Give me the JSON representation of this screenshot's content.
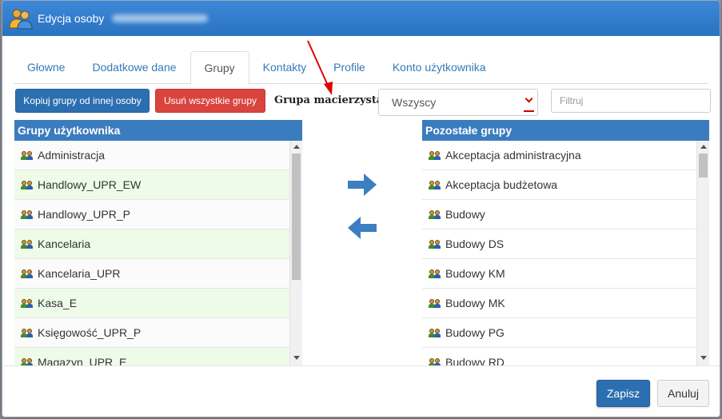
{
  "window": {
    "title": "Edycja osoby"
  },
  "tabs": [
    {
      "label": "Głowne",
      "active": false
    },
    {
      "label": "Dodatkowe dane",
      "active": false
    },
    {
      "label": "Grupy",
      "active": true
    },
    {
      "label": "Kontakty",
      "active": false
    },
    {
      "label": "Profile",
      "active": false
    },
    {
      "label": "Konto użytkownika",
      "active": false
    }
  ],
  "toolbar": {
    "copy_label": "Kopiuj grupy od innej osoby",
    "remove_label": "Usuń wszystkie grupy",
    "parent_group_label": "Grupa macierzysta:",
    "parent_group_value": "Wszyscy",
    "filter_placeholder": "Filtruj"
  },
  "left_panel": {
    "header": "Grupy użytkownika",
    "items": [
      "Administracja",
      "Handlowy_UPR_EW",
      "Handlowy_UPR_P",
      "Kancelaria",
      "Kancelaria_UPR",
      "Kasa_E",
      "Księgowość_UPR_P",
      "Magazyn_UPR_E"
    ]
  },
  "right_panel": {
    "header": "Pozostałe grupy",
    "items": [
      "Akceptacja administracyjna",
      "Akceptacja budżetowa",
      "Budowy",
      "Budowy DS",
      "Budowy KM",
      "Budowy MK",
      "Budowy PG",
      "Budowy RD"
    ]
  },
  "footer": {
    "save_label": "Zapisz",
    "cancel_label": "Anuluj"
  },
  "colors": {
    "accent": "#2c6fb0",
    "danger": "#d9443f",
    "header": "#3b7cbf",
    "row_alt": "#eefbe8",
    "annotation": "#e00000"
  },
  "icons": {
    "title": "users-icon",
    "row": "group-icon",
    "move_right": "arrow-right-icon",
    "move_left": "arrow-left-icon",
    "dropdown": "chevron-down-icon"
  }
}
